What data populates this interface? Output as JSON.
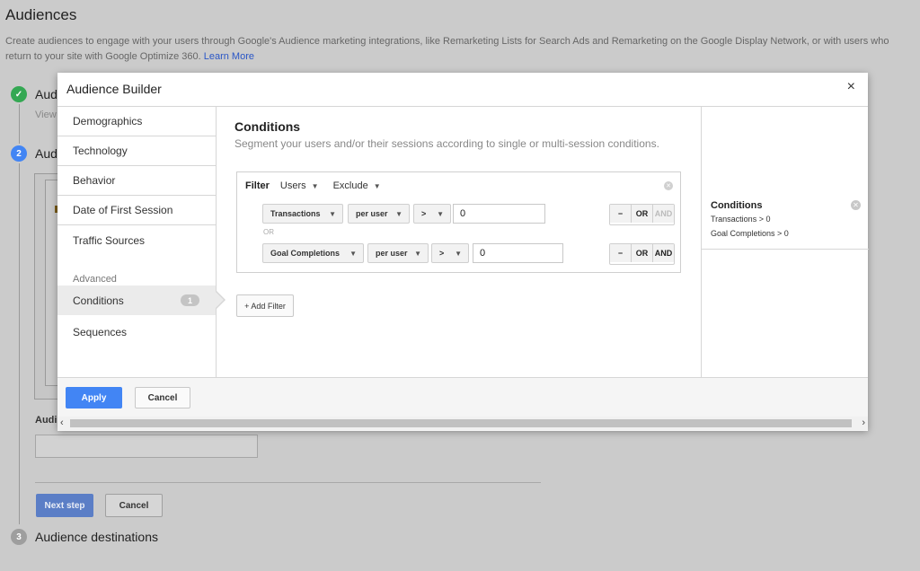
{
  "page": {
    "title": "Audiences",
    "description": "Create audiences to engage with your users through Google's Audience marketing integrations, like Remarketing Lists for Search Ads and Remarketing on the Google Display Network, or with users who return to your site with Google Optimize 360.",
    "learn_more": "Learn More",
    "step1_label": "Aud",
    "step1_sub": "View",
    "step2_num": "2",
    "step2_label": "Aud",
    "audience_name_label": "Audi",
    "next_step": "Next step",
    "cancel": "Cancel",
    "step3_num": "3",
    "step3_label": "Audience destinations",
    "colors": {
      "accent": "#4285f4",
      "success": "#34a853"
    }
  },
  "modal": {
    "title": "Audience Builder",
    "close": "×",
    "nav": {
      "items": [
        "Demographics",
        "Technology",
        "Behavior",
        "Date of First Session",
        "Traffic Sources"
      ],
      "advanced_label": "Advanced",
      "conditions": "Conditions",
      "conditions_count": "1",
      "sequences": "Sequences"
    },
    "conditions": {
      "title": "Conditions",
      "description": "Segment your users and/or their sessions according to single or multi-session conditions.",
      "filter_label": "Filter",
      "scope": "Users",
      "mode": "Exclude",
      "rows": [
        {
          "dimension": "Transactions",
          "per": "per user",
          "op": ">",
          "value": "0",
          "minus": "−",
          "or": "OR",
          "and": "AND"
        },
        {
          "dimension": "Goal Completions",
          "per": "per user",
          "op": ">",
          "value": "0",
          "minus": "−",
          "or": "OR",
          "and": "AND"
        }
      ],
      "or_separator": "OR",
      "add_filter": "+ Add Filter"
    },
    "summary": {
      "title": "Conditions",
      "lines": [
        "Transactions > 0",
        "Goal Completions > 0"
      ]
    },
    "footer": {
      "apply": "Apply",
      "cancel": "Cancel"
    }
  }
}
